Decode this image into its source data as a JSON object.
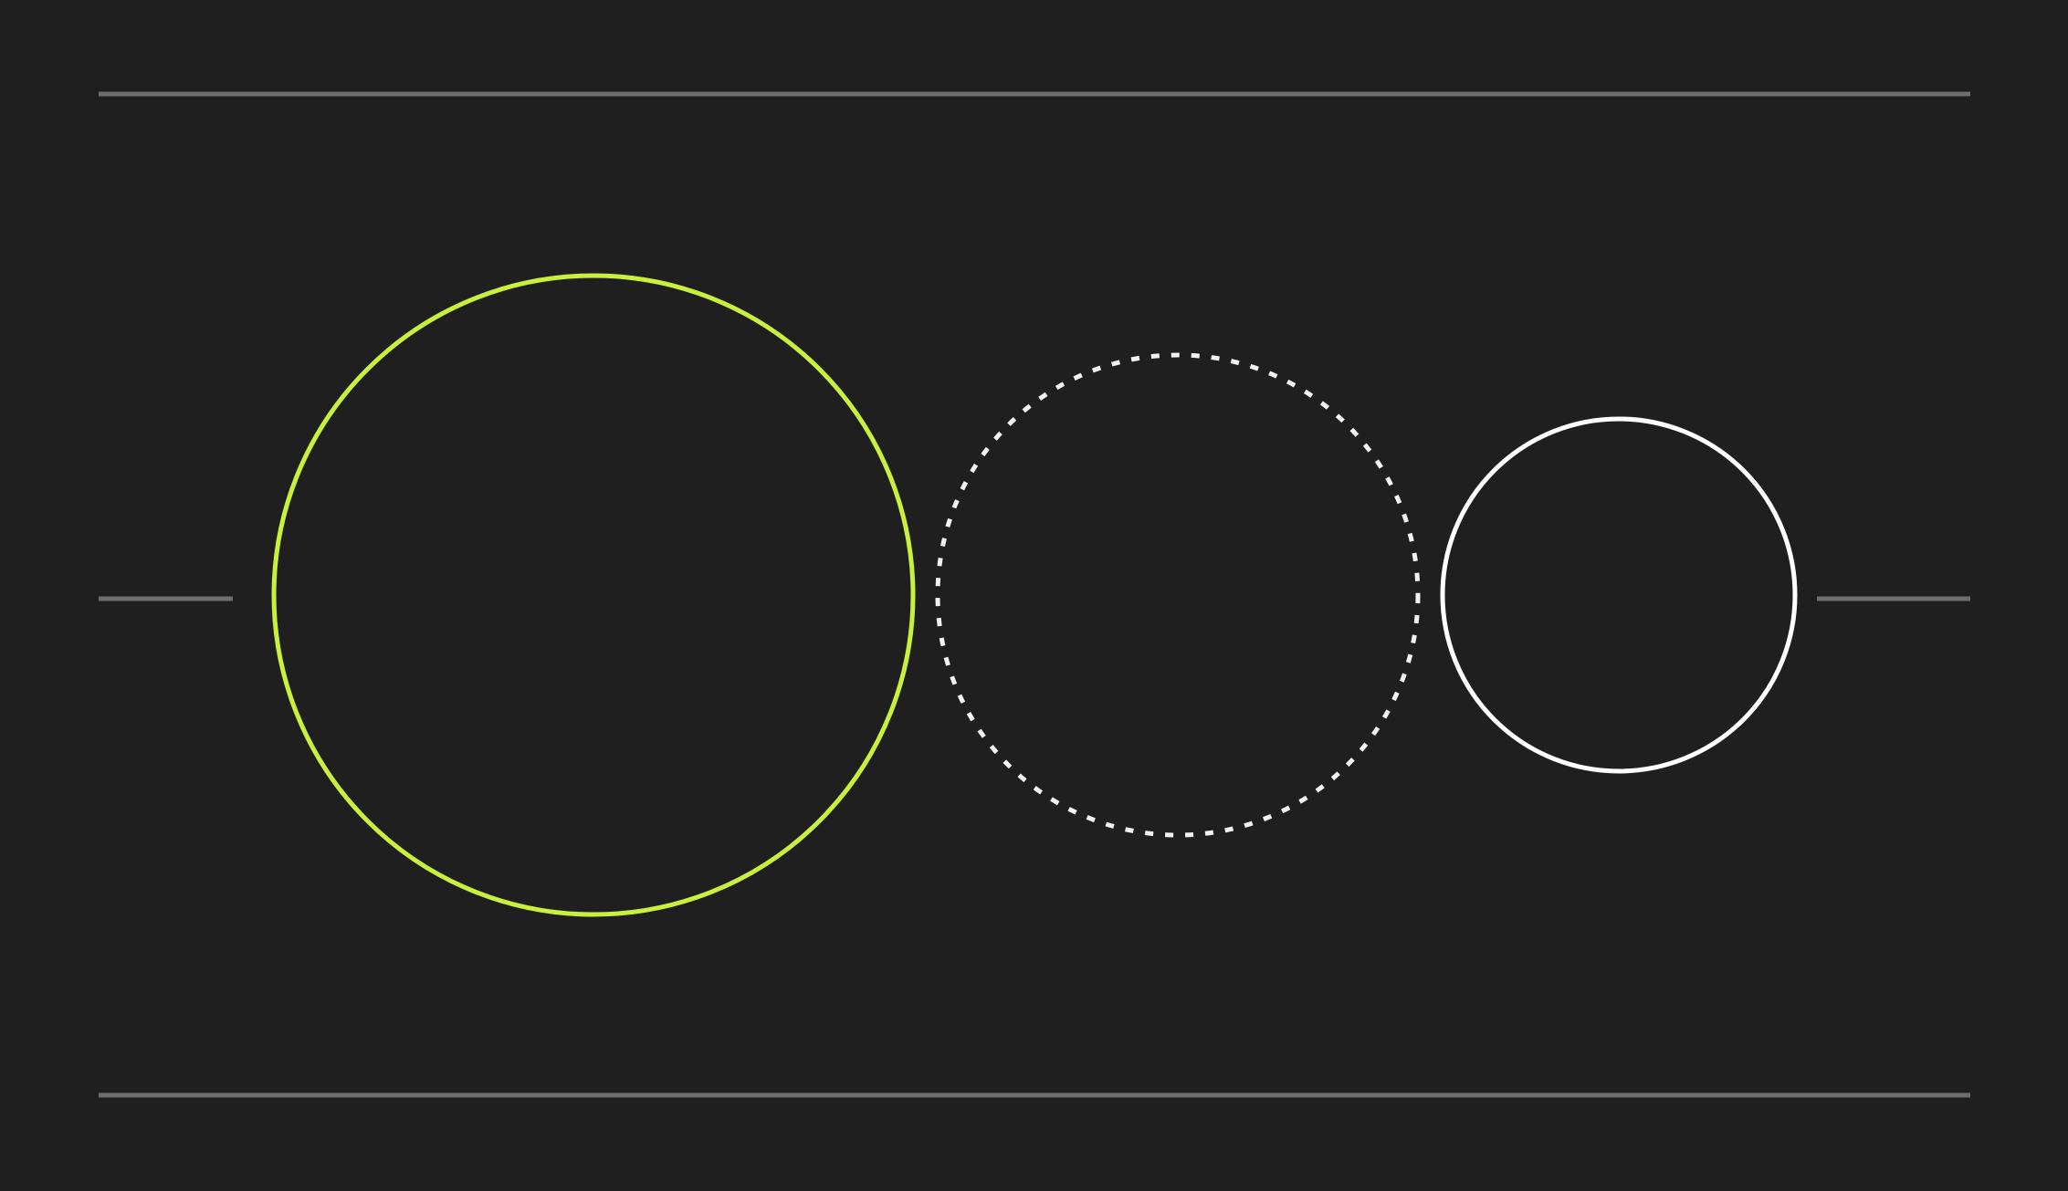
{
  "colors": {
    "background": "#1f1f1f",
    "rule": "#6e6e6e",
    "accent_circle": "#c8f03c",
    "dotted_circle": "#f2f2f2",
    "solid_circle": "#ffffff"
  },
  "elements": {
    "rules": [
      "top-rule",
      "bottom-rule",
      "left-midline-segment",
      "right-midline-segment"
    ],
    "circles": [
      {
        "name": "large-accent-circle",
        "style": "solid",
        "color_key": "accent_circle"
      },
      {
        "name": "medium-dotted-circle",
        "style": "dotted",
        "color_key": "dotted_circle"
      },
      {
        "name": "small-white-circle",
        "style": "solid",
        "color_key": "solid_circle"
      }
    ]
  }
}
